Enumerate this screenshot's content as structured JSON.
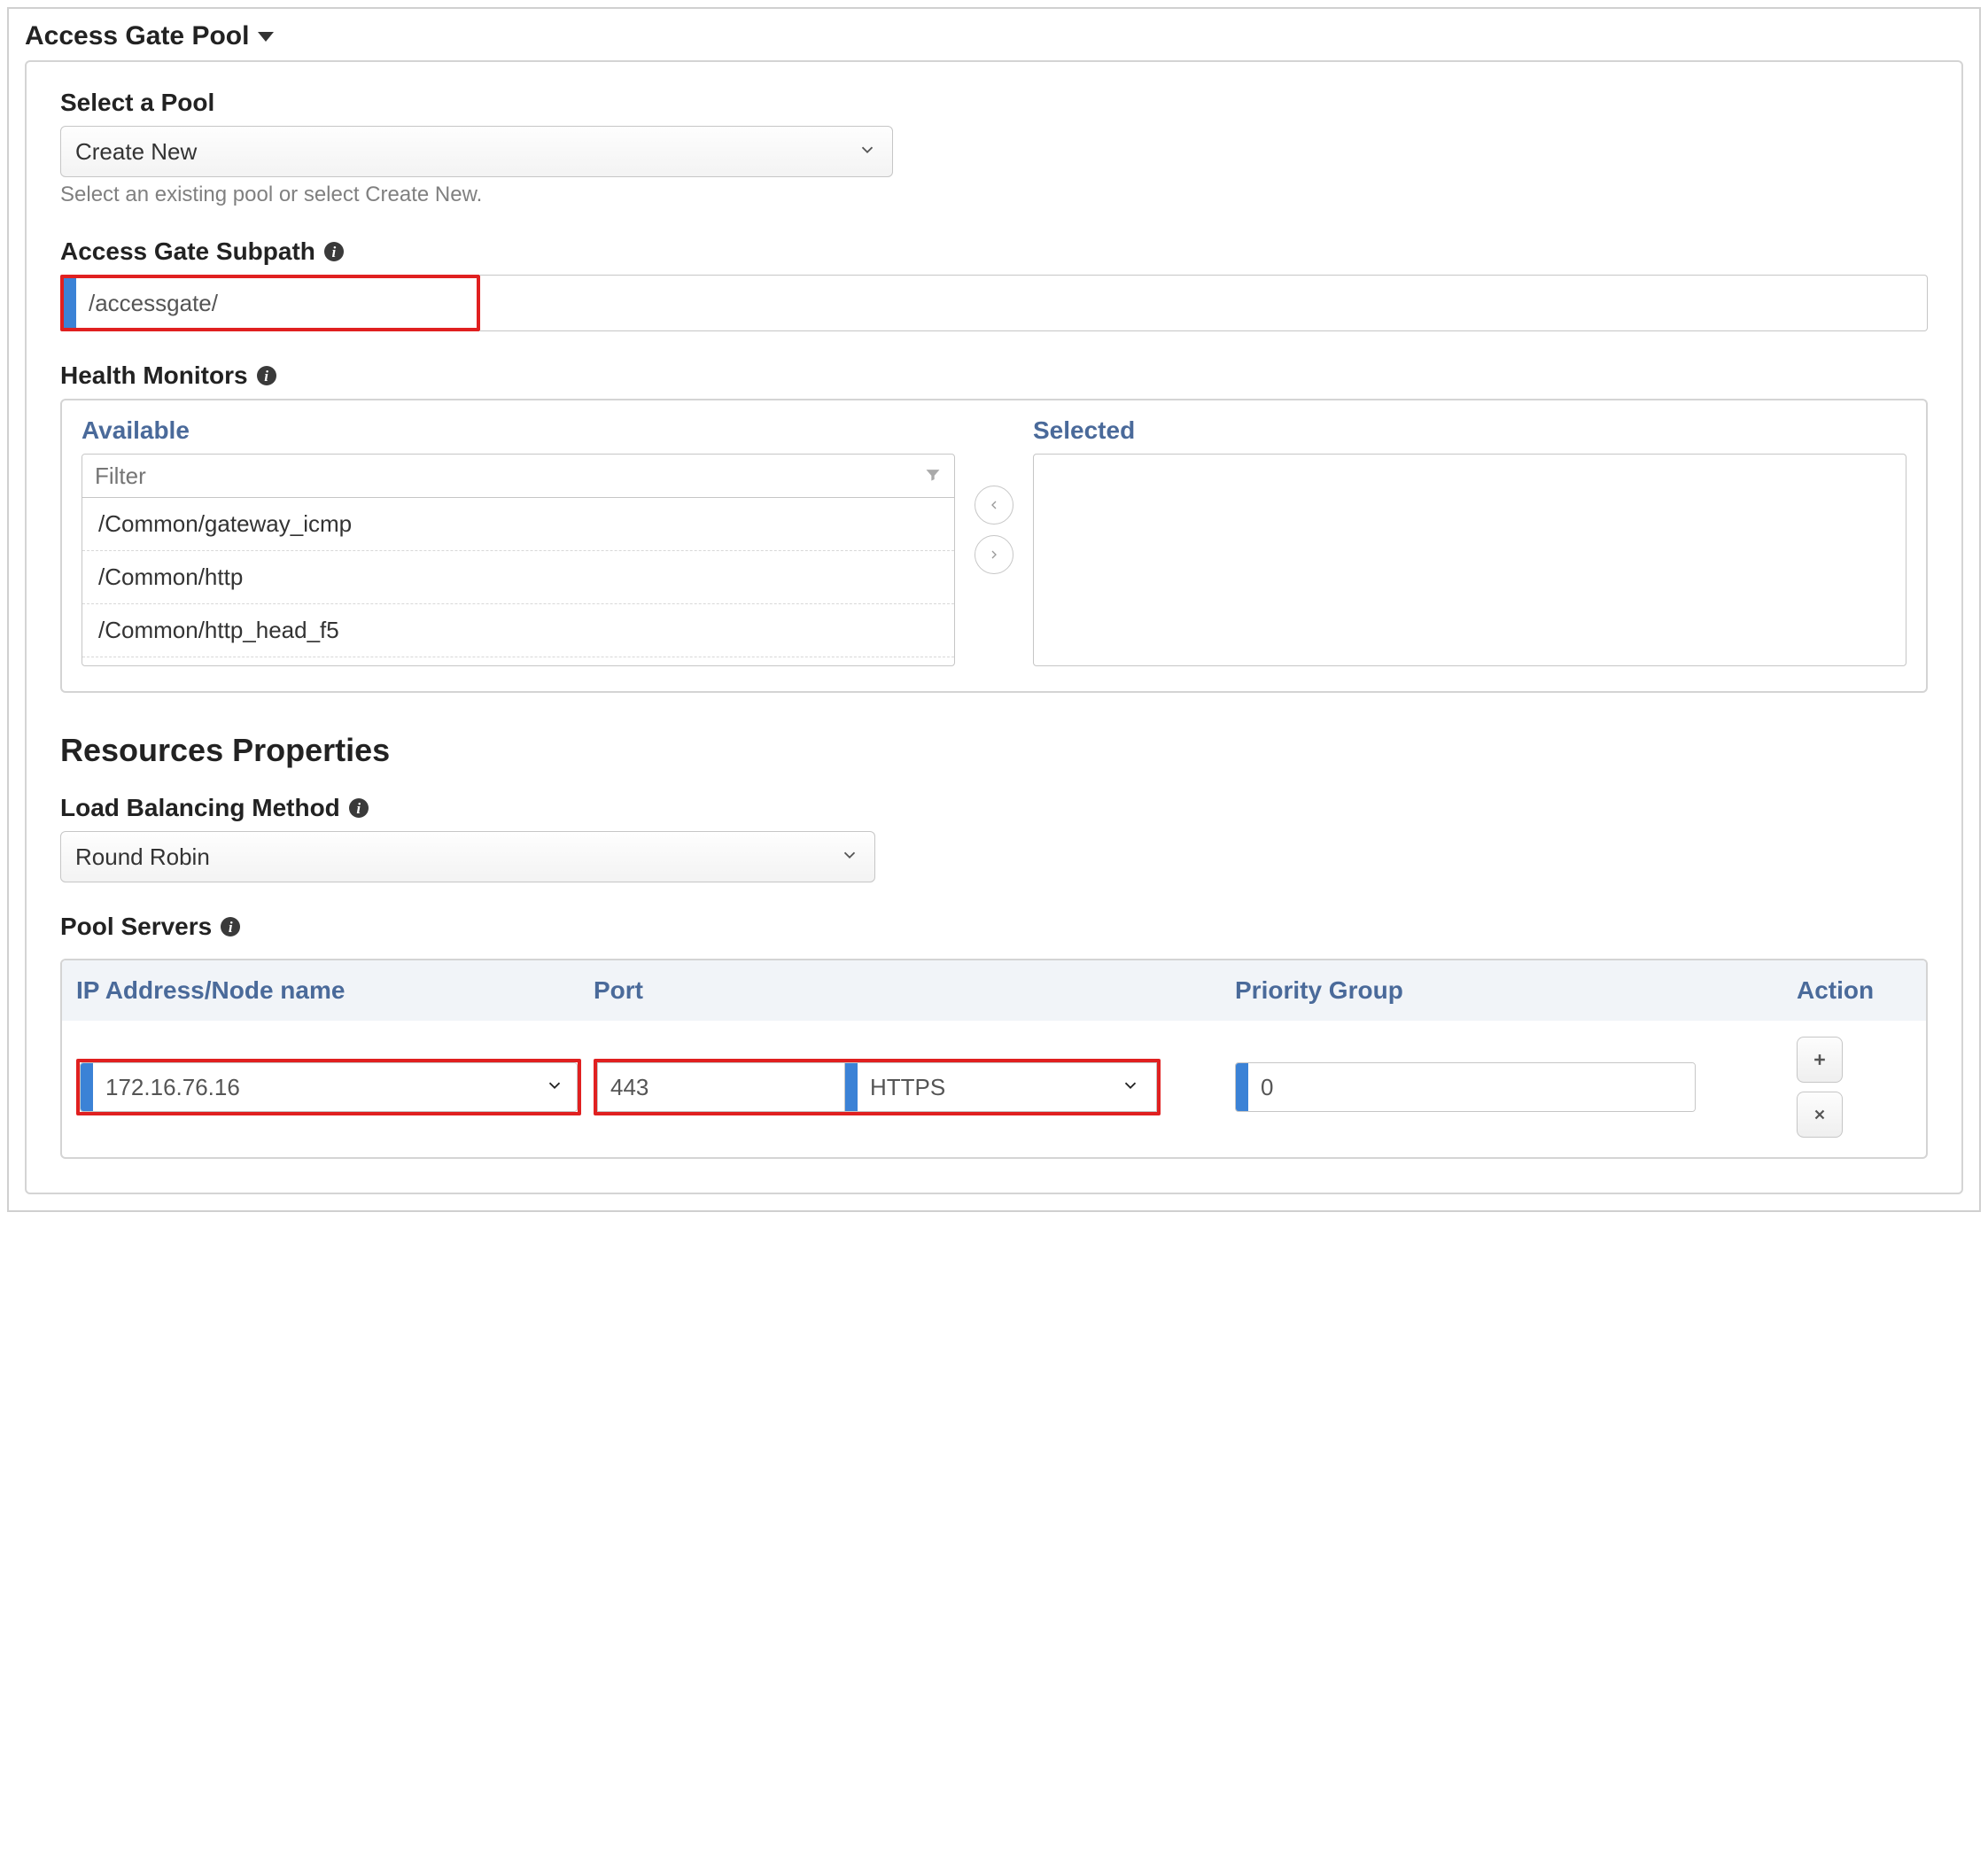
{
  "section_title": "Access Gate Pool",
  "select_pool": {
    "label": "Select a Pool",
    "value": "Create New",
    "help": "Select an existing pool or select Create New."
  },
  "subpath": {
    "label": "Access Gate Subpath",
    "value": "/accessgate/"
  },
  "health_monitors": {
    "label": "Health Monitors",
    "available_label": "Available",
    "selected_label": "Selected",
    "filter_placeholder": "Filter",
    "items": [
      "/Common/gateway_icmp",
      "/Common/http",
      "/Common/http_head_f5"
    ]
  },
  "resources_heading": "Resources Properties",
  "lbm": {
    "label": "Load Balancing Method",
    "value": "Round Robin"
  },
  "pool_servers": {
    "label": "Pool Servers",
    "headers": {
      "ip": "IP Address/Node name",
      "port": "Port",
      "pg": "Priority Group",
      "action": "Action"
    },
    "row": {
      "ip": "172.16.76.16",
      "port": "443",
      "proto": "HTTPS",
      "pg": "0"
    }
  }
}
